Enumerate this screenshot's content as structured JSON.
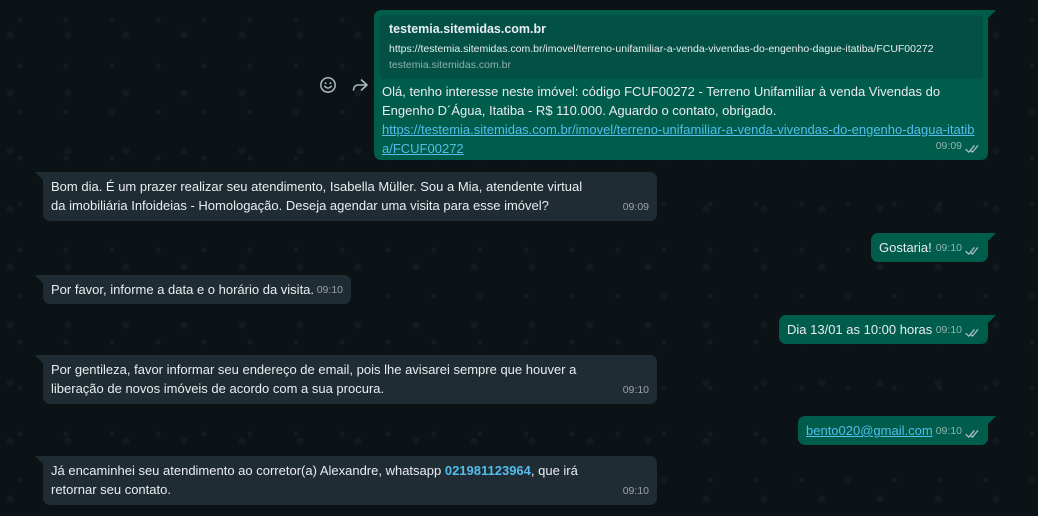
{
  "preview": {
    "title": "testemia.sitemidas.com.br",
    "url": "https://testemia.sitemidas.com.br/imovel/terreno-unifamiliar-a-venda-vivendas-do-engenho-dague-itatiba/FCUF00272",
    "domain": "testemia.sitemidas.com.br"
  },
  "messages": [
    {
      "direction": "out",
      "text": "Olá, tenho interesse neste imóvel: código FCUF00272 - Terreno Unifamiliar à venda Vivendas do Engenho D´Água, Itatiba - R$ 110.000. Aguardo o contato, obrigado.",
      "link": "https://testemia.sitemidas.com.br/imovel/terreno-unifamiliar-a-venda-vivendas-do-engenho-dagua-itatiba/FCUF00272",
      "time": "09:09"
    },
    {
      "direction": "in",
      "text": "Bom dia. É um prazer realizar seu atendimento, Isabella Müller. Sou a Mia, atendente virtual da imobiliária Infoideias - Homologação. Deseja agendar uma visita para esse imóvel?",
      "time": "09:09"
    },
    {
      "direction": "out",
      "text": "Gostaria!",
      "time": "09:10"
    },
    {
      "direction": "in",
      "text": "Por favor, informe a data e o horário da visita.",
      "time": "09:10"
    },
    {
      "direction": "out",
      "text": "Dia 13/01 as 10:00 horas",
      "time": "09:10"
    },
    {
      "direction": "in",
      "text": "Por gentileza, favor informar seu endereço de email, pois lhe avisarei sempre que houver a liberação de novos imóveis de acordo com a sua procura.",
      "time": "09:10"
    },
    {
      "direction": "out",
      "text": "bento020@gmail.com",
      "time": "09:10"
    },
    {
      "direction": "in",
      "text_before": "Já encaminhei seu atendimento ao corretor(a) Alexandre, whatsapp ",
      "phone": "021981123964",
      "text_after": ", que  irá retornar seu contato.",
      "time": "09:10"
    }
  ],
  "icons": {
    "emoji": "emoji-icon",
    "forward": "forward-icon",
    "read_receipt": "double-check-icon"
  },
  "colors": {
    "incoming_bubble": "#202c33",
    "outgoing_bubble": "#005c4b",
    "link": "#53bdeb",
    "read_tick": "#53bdeb"
  }
}
